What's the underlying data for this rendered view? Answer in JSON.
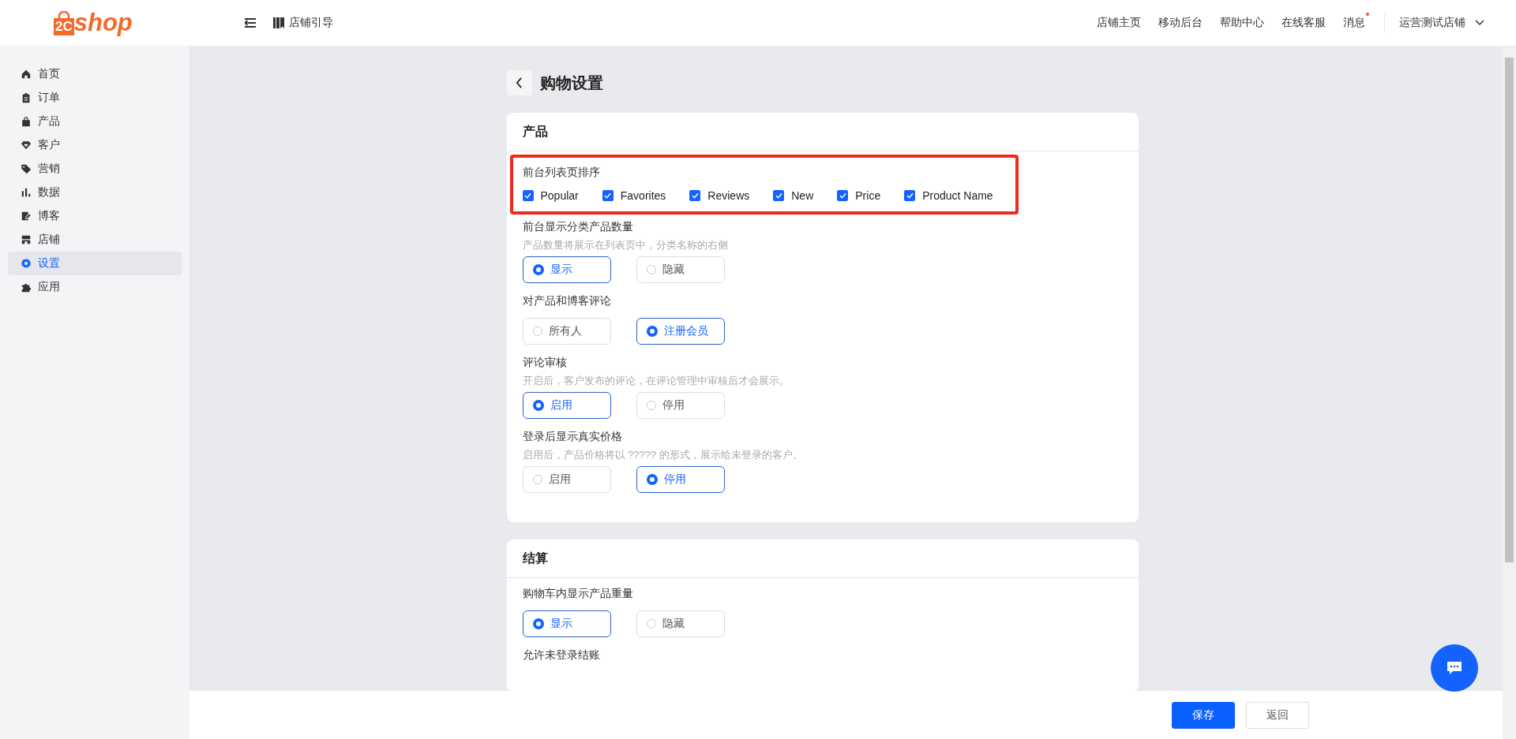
{
  "header": {
    "logo": {
      "badge": "2C",
      "text": "shop"
    },
    "guide": "店铺引导",
    "links": [
      "店铺主页",
      "移动后台",
      "帮助中心",
      "在线客服"
    ],
    "messages": {
      "label": "消息",
      "unread": true
    },
    "store": "运营测试店铺"
  },
  "sidebar": {
    "items": [
      {
        "label": "首页",
        "selected": false
      },
      {
        "label": "订单",
        "selected": false
      },
      {
        "label": "产品",
        "selected": false
      },
      {
        "label": "客户",
        "selected": false
      },
      {
        "label": "营销",
        "selected": false
      },
      {
        "label": "数据",
        "selected": false
      },
      {
        "label": "博客",
        "selected": false
      },
      {
        "label": "店铺",
        "selected": false
      },
      {
        "label": "设置",
        "selected": true
      },
      {
        "label": "应用",
        "selected": false
      }
    ]
  },
  "page": {
    "title": "购物设置"
  },
  "cards": [
    {
      "title": "产品",
      "settings": [
        {
          "kind": "checkboxes",
          "label": "前台列表页排序",
          "highlighted": true,
          "options": [
            {
              "label": "Popular",
              "checked": true
            },
            {
              "label": "Favorites",
              "checked": true
            },
            {
              "label": "Reviews",
              "checked": true
            },
            {
              "label": "New",
              "checked": true
            },
            {
              "label": "Price",
              "checked": true
            },
            {
              "label": "Product Name",
              "checked": true
            }
          ]
        },
        {
          "kind": "radios",
          "label": "前台显示分类产品数量",
          "description": "产品数量将展示在列表页中，分类名称的右侧",
          "options": [
            {
              "label": "显示",
              "selected": true
            },
            {
              "label": "隐藏",
              "selected": false
            }
          ]
        },
        {
          "kind": "radios",
          "label": "对产品和博客评论",
          "options": [
            {
              "label": "所有人",
              "selected": false
            },
            {
              "label": "注册会员",
              "selected": true
            }
          ]
        },
        {
          "kind": "radios",
          "label": "评论审核",
          "description": "开启后，客户发布的评论，在评论管理中审核后才会展示。",
          "options": [
            {
              "label": "启用",
              "selected": true
            },
            {
              "label": "停用",
              "selected": false
            }
          ]
        },
        {
          "kind": "radios",
          "label": "登录后显示真实价格",
          "description": "启用后，产品价格将以 ????? 的形式，展示给未登录的客户。",
          "options": [
            {
              "label": "启用",
              "selected": false
            },
            {
              "label": "停用",
              "selected": true
            }
          ]
        }
      ]
    },
    {
      "title": "结算",
      "settings": [
        {
          "kind": "radios",
          "label": "购物车内显示产品重量",
          "options": [
            {
              "label": "显示",
              "selected": true
            },
            {
              "label": "隐藏",
              "selected": false
            }
          ]
        },
        {
          "kind": "heading",
          "label": "允许未登录结账"
        }
      ]
    }
  ],
  "footer": {
    "buttons": [
      {
        "label": "保存",
        "kind": "primary"
      },
      {
        "label": "返回",
        "kind": "secondary"
      }
    ]
  }
}
